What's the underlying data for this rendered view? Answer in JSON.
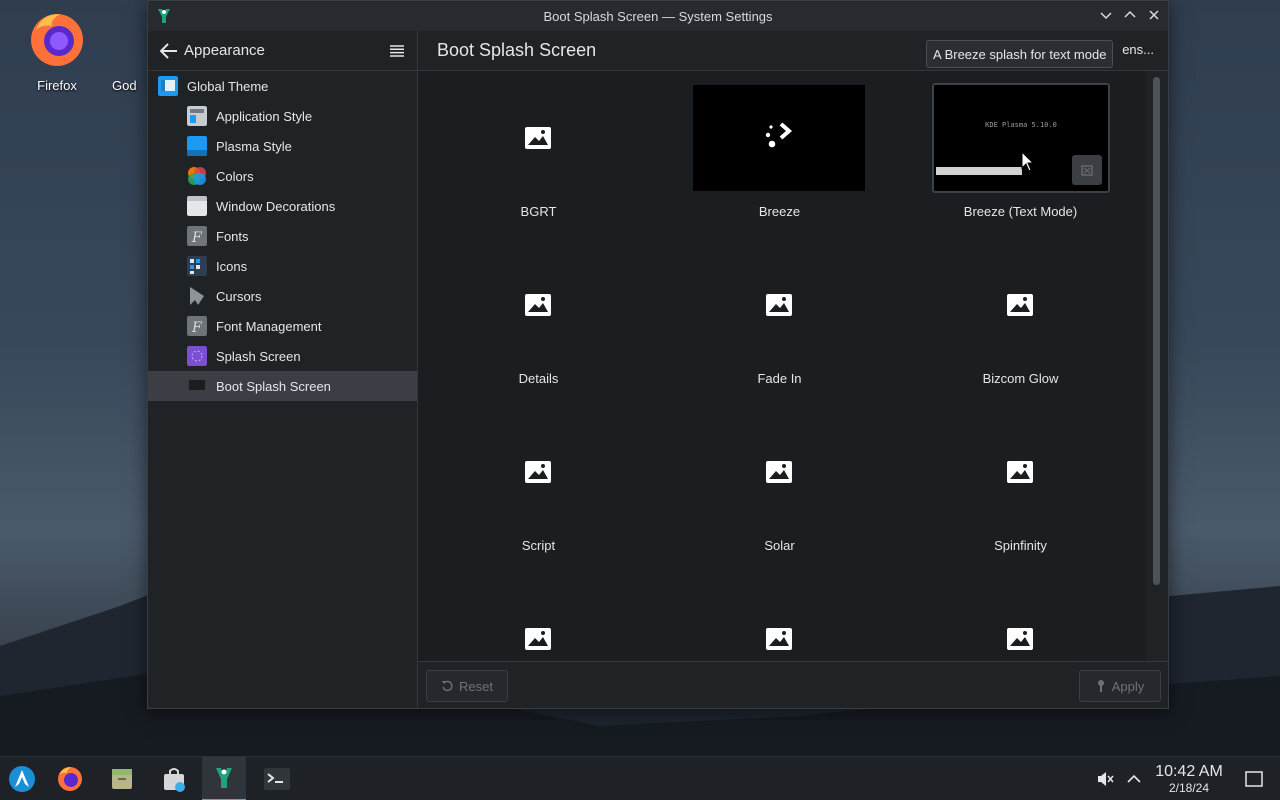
{
  "desktop": {
    "icons": [
      {
        "label": "Firefox"
      },
      {
        "label": "God"
      }
    ]
  },
  "window": {
    "title": "Boot Splash Screen — System Settings"
  },
  "sidebar": {
    "header": "Appearance",
    "items": [
      {
        "label": "Global Theme",
        "icon": "global-theme-icon",
        "level": 0
      },
      {
        "label": "Application Style",
        "icon": "application-style-icon",
        "level": 1
      },
      {
        "label": "Plasma Style",
        "icon": "plasma-style-icon",
        "level": 1
      },
      {
        "label": "Colors",
        "icon": "colors-icon",
        "level": 1
      },
      {
        "label": "Window Decorations",
        "icon": "window-decorations-icon",
        "level": 1
      },
      {
        "label": "Fonts",
        "icon": "fonts-icon",
        "level": 1
      },
      {
        "label": "Icons",
        "icon": "icons-icon",
        "level": 1
      },
      {
        "label": "Cursors",
        "icon": "cursors-icon",
        "level": 1
      },
      {
        "label": "Font Management",
        "icon": "font-management-icon",
        "level": 1
      },
      {
        "label": "Splash Screen",
        "icon": "splash-screen-icon",
        "level": 1
      },
      {
        "label": "Boot Splash Screen",
        "icon": "boot-splash-icon",
        "level": 1,
        "selected": true
      }
    ]
  },
  "main": {
    "title": "Boot Splash Screen",
    "get_new_label": "ens...",
    "tooltip": "A Breeze splash for text mode",
    "text_mode_preview": "KDE Plasma 5.10.0",
    "themes": [
      {
        "label": "BGRT",
        "preview": "placeholder"
      },
      {
        "label": "Breeze",
        "preview": "breeze"
      },
      {
        "label": "Breeze (Text Mode)",
        "preview": "textmode",
        "hovered": true
      },
      {
        "label": "Details",
        "preview": "placeholder"
      },
      {
        "label": "Fade In",
        "preview": "placeholder"
      },
      {
        "label": "Bizcom Glow",
        "preview": "placeholder"
      },
      {
        "label": "Script",
        "preview": "placeholder"
      },
      {
        "label": "Solar",
        "preview": "placeholder"
      },
      {
        "label": "Spinfinity",
        "preview": "placeholder"
      },
      {
        "label": "",
        "preview": "placeholder"
      },
      {
        "label": "",
        "preview": "placeholder"
      },
      {
        "label": "",
        "preview": "placeholder"
      }
    ],
    "reset_label": "Reset",
    "apply_label": "Apply"
  },
  "taskbar": {
    "time": "10:42 AM",
    "date": "2/18/24"
  },
  "colors": {
    "accent": "#3daee9",
    "window_bg": "#202326",
    "view_bg": "#1b1e20"
  }
}
